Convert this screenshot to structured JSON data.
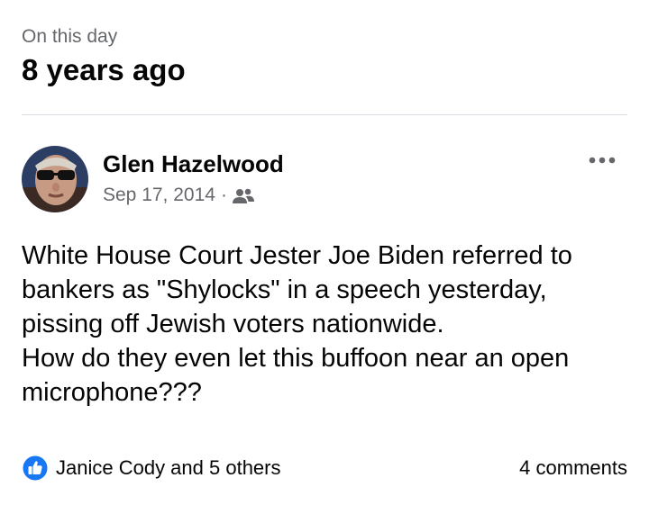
{
  "memory": {
    "caption": "On this day",
    "years_ago": "8 years ago"
  },
  "post": {
    "author": "Glen Hazelwood",
    "date": "Sep 17, 2014",
    "separator": "·",
    "audience_icon": "friends-icon",
    "more_icon": "more-options-icon",
    "body": "White House Court Jester Joe Biden referred to bankers as \"Shylocks\" in a speech yesterday, pissing off Jewish voters nationwide.\nHow do they even let this buffoon near an open microphone???"
  },
  "footer": {
    "reaction_icon": "like-icon",
    "reactions_text": "Janice Cody and 5 others",
    "comments_text": "4 comments"
  },
  "colors": {
    "secondary_text": "#65676b",
    "primary_text": "#050505",
    "like_blue": "#1877f2",
    "divider": "#dadde1"
  }
}
